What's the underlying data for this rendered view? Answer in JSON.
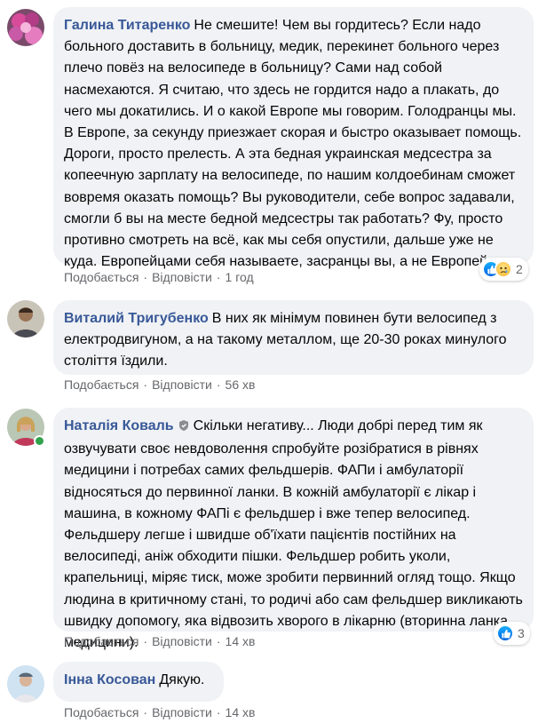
{
  "comments": [
    {
      "author": "Галина Титаренко",
      "text": "Не смешите! Чем вы гордитесь? Если надо больного доставить в больницу, медик, перекинет больного через плечо повёз на велосипеде в больницу? Сами над собой насмехаются. Я считаю, что здесь не гордится надо а плакать, до чего мы докатились. И о какой Европе мы говорим. Голодранцы мы. В Европе, за секунду приезжает скорая и быстро оказывает помощь. Дороги, просто прелесть. А эта бедная украинская медсестра за копеечную зарплату на велосипеде, по нашим колдоебинам сможет вовремя оказать помощь? Вы руководители, себе вопрос задавали, смогли б вы на месте бедной медсестры так работать? Фу, просто противно смотреть на всё, как мы себя опустили, дальше уже не куда. Европейцами себя называете, засранцы вы, а не Европейцы.",
      "like_label": "Подобається",
      "reply_label": "Відповісти",
      "time": "1 год",
      "reaction_count": "2",
      "reactions": [
        "like-icon",
        "sad-icon"
      ]
    },
    {
      "author": "Виталий Тригубенко",
      "text": "В них як мінімум повинен бути велосипед з електродвигуном, а на такому металлом, ще 20-30 роках минулого століття їздили.",
      "like_label": "Подобається",
      "reply_label": "Відповісти",
      "time": "56 хв"
    },
    {
      "author": "Наталія Коваль",
      "text": "Скільки негативу... Люди добрі перед тим як озвучувати своє невдоволення спробуйте розібратися в рівнях медицини і потребах самих фельдшерів. ФАПи і амбулаторії відносяться до первинної ланки. В кожній амбулаторії є лікар і машина, в кожному ФАПі є фельдшер і вже тепер велосипед. Фельдшеру легше і швидше об'їхати пацієнтів постійних на велосипеді, аніж обходити пішки. Фельдшер робить уколи, крапельниці, міряє тиск, може зробити первинний огляд тощо. Якщо людина в критичному стані, то родичі або сам фельдшер викликають швидку допомогу, яка відвозить хворого в лікарню (вторинна ланка медицини).",
      "like_label": "Подобається",
      "reply_label": "Відповісти",
      "time": "14 хв",
      "reaction_count": "3",
      "reactions": [
        "like-icon"
      ]
    },
    {
      "author": "Інна Косован",
      "text": "Дякую.",
      "like_label": "Подобається",
      "reply_label": "Відповісти",
      "time": "14 хв"
    }
  ],
  "colors": {
    "bubble": "#f0f2f5",
    "author": "#385898",
    "meta": "#65676b",
    "online": "#31a24c"
  }
}
